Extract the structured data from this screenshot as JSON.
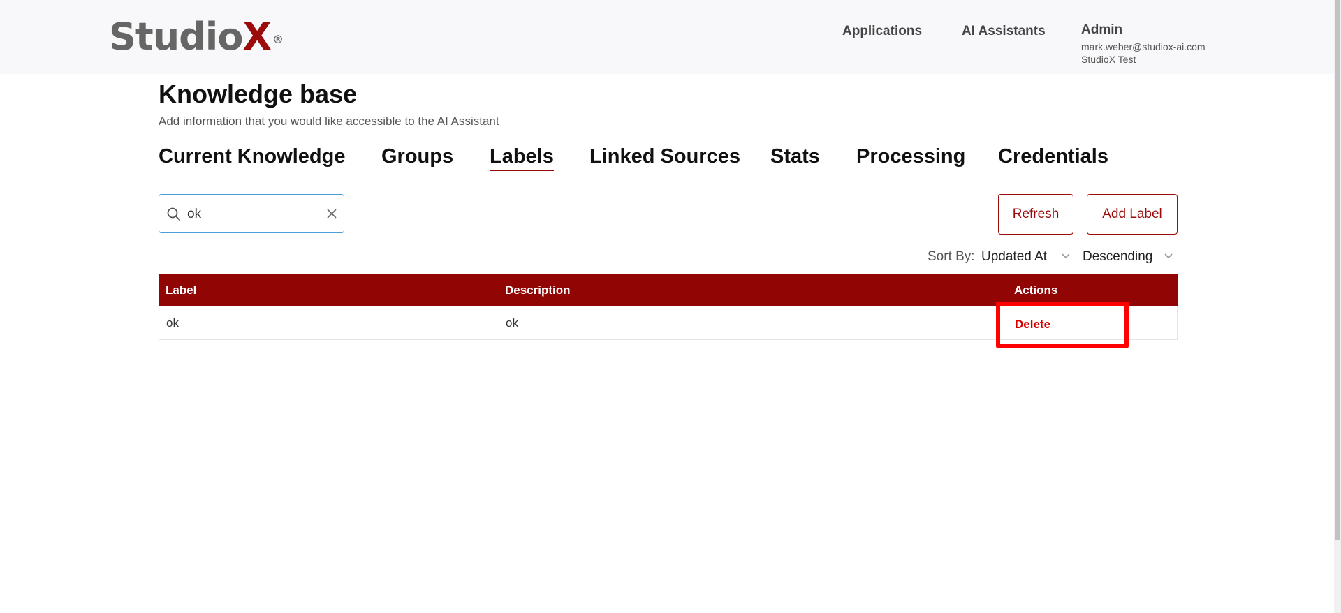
{
  "header": {
    "logo": {
      "text": "Studio",
      "accent": "X",
      "reg": "®"
    },
    "nav": [
      {
        "label": "Applications"
      },
      {
        "label": "AI Assistants"
      }
    ],
    "user": {
      "role": "Admin",
      "email": "mark.weber@studiox-ai.com",
      "org": "StudioX Test"
    }
  },
  "page": {
    "title": "Knowledge base",
    "subtitle": "Add information that you would like accessible to the AI Assistant"
  },
  "tabs": [
    {
      "label": "Current Knowledge",
      "active": false
    },
    {
      "label": "Groups",
      "active": false
    },
    {
      "label": "Labels",
      "active": true
    },
    {
      "label": "Linked Sources",
      "active": false
    },
    {
      "label": "Stats",
      "active": false
    },
    {
      "label": "Processing",
      "active": false
    },
    {
      "label": "Credentials",
      "active": false
    }
  ],
  "search": {
    "value": "ok",
    "icon": "search-icon"
  },
  "toolbar": {
    "refresh_label": "Refresh",
    "add_label": "Add Label"
  },
  "sort": {
    "label": "Sort By:",
    "field": "Updated At",
    "order": "Descending"
  },
  "table": {
    "columns": [
      "Label",
      "Description",
      "Actions"
    ],
    "rows": [
      {
        "label": "ok",
        "description": "ok",
        "action": "Delete"
      }
    ]
  },
  "colors": {
    "brand": "#920505",
    "accent_link": "#d40000",
    "focus": "#4a9fd8",
    "highlight": "#ff0000"
  }
}
